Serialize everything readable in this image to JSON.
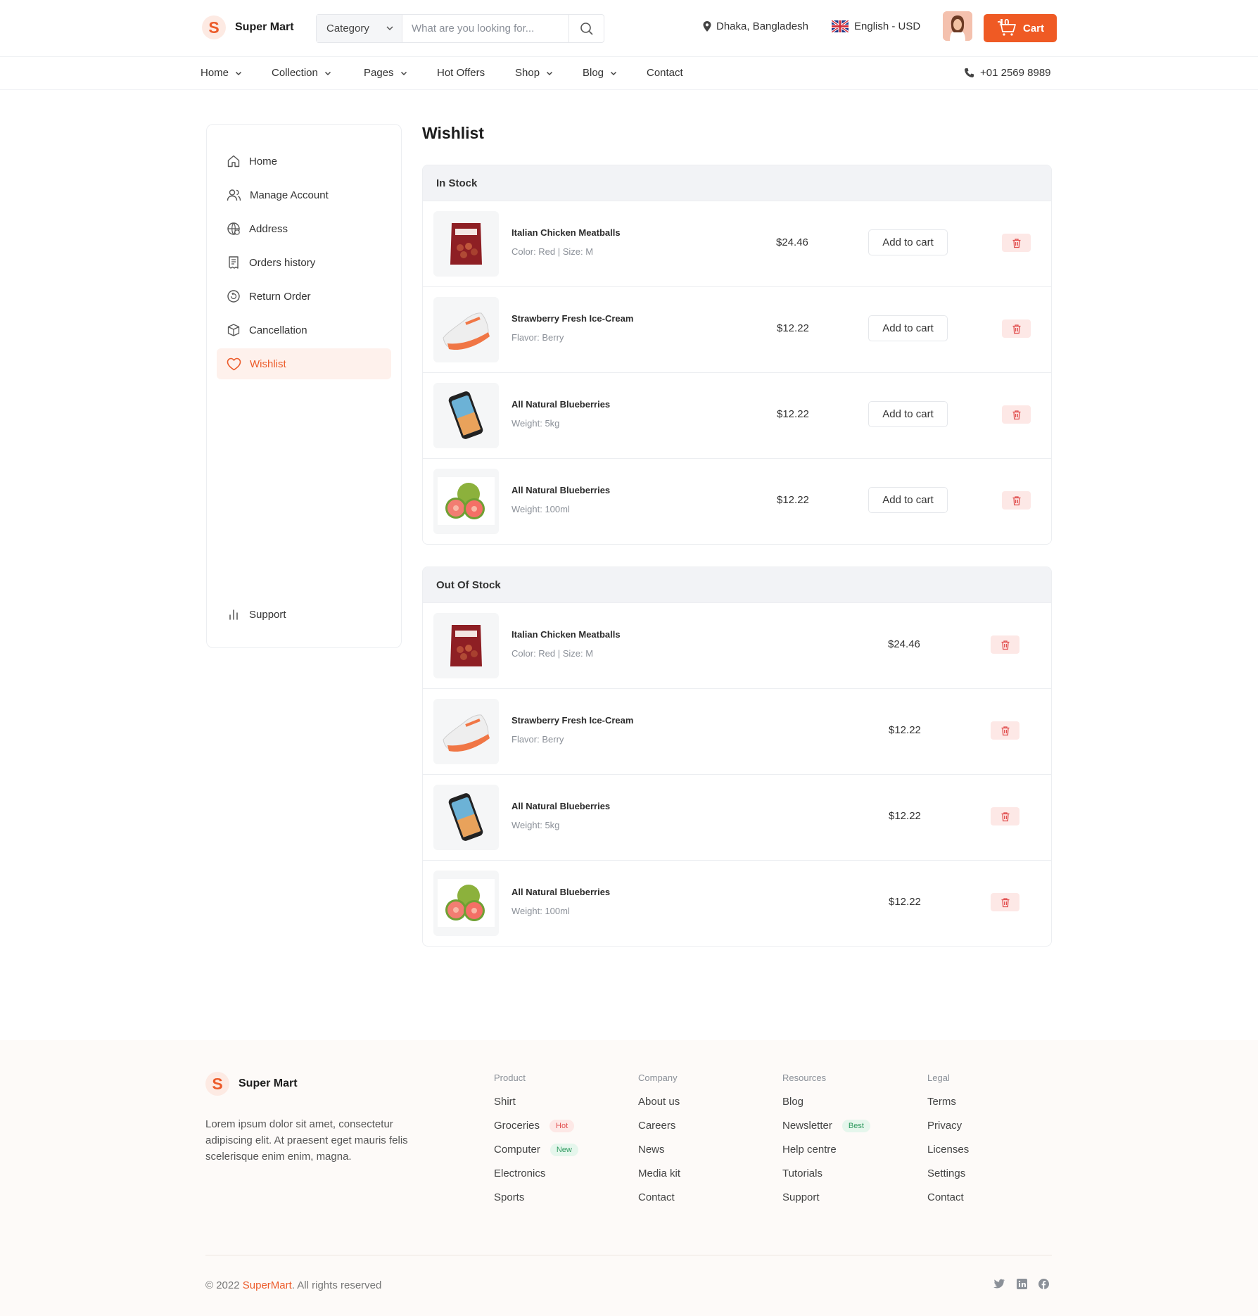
{
  "brand": {
    "name": "Super Mart",
    "letter": "S",
    "accent": "#ef5a24"
  },
  "header": {
    "category_label": "Category",
    "search_placeholder": "What are you looking for...",
    "location": "Dhaka, Bangladesh",
    "language": "English - USD",
    "cart_label": "Cart",
    "cart_count": "10"
  },
  "nav": {
    "items": [
      {
        "label": "Home",
        "has_dropdown": true
      },
      {
        "label": "Collection",
        "has_dropdown": true
      },
      {
        "label": "Pages",
        "has_dropdown": true
      },
      {
        "label": "Hot Offers",
        "has_dropdown": false
      },
      {
        "label": "Shop",
        "has_dropdown": true
      },
      {
        "label": "Blog",
        "has_dropdown": true
      },
      {
        "label": "Contact",
        "has_dropdown": false
      }
    ],
    "phone": "+01 2569 8989"
  },
  "sidebar": {
    "items": [
      {
        "label": "Home",
        "icon": "home-icon"
      },
      {
        "label": "Manage Account",
        "icon": "users-icon"
      },
      {
        "label": "Address",
        "icon": "globe-icon"
      },
      {
        "label": "Orders history",
        "icon": "receipt-icon"
      },
      {
        "label": "Return Order",
        "icon": "return-icon"
      },
      {
        "label": "Cancellation",
        "icon": "box-icon"
      },
      {
        "label": "Wishlist",
        "icon": "heart-icon",
        "active": true
      }
    ],
    "support": "Support"
  },
  "main": {
    "title": "Wishlist",
    "in_stock": {
      "heading": "In Stock",
      "add_label": "Add to cart",
      "items": [
        {
          "name": "Italian Chicken Meatballs",
          "meta": "Color: Red | Size: M",
          "price": "$24.46",
          "image": "meatball-pack"
        },
        {
          "name": "Strawberry Fresh Ice-Cream",
          "meta": "Flavor: Berry",
          "price": "$12.22",
          "image": "sneaker"
        },
        {
          "name": "All Natural Blueberries",
          "meta": "Weight: 5kg",
          "price": "$12.22",
          "image": "phone"
        },
        {
          "name": "All Natural Blueberries",
          "meta": "Weight: 100ml",
          "price": "$12.22",
          "image": "guava"
        }
      ]
    },
    "out_of_stock": {
      "heading": "Out Of Stock",
      "items": [
        {
          "name": "Italian Chicken Meatballs",
          "meta": "Color: Red | Size: M",
          "price": "$24.46",
          "image": "meatball-pack"
        },
        {
          "name": "Strawberry Fresh Ice-Cream",
          "meta": "Flavor: Berry",
          "price": "$12.22",
          "image": "sneaker"
        },
        {
          "name": "All Natural Blueberries",
          "meta": "Weight: 5kg",
          "price": "$12.22",
          "image": "phone"
        },
        {
          "name": "All Natural Blueberries",
          "meta": "Weight: 100ml",
          "price": "$12.22",
          "image": "guava"
        }
      ]
    }
  },
  "footer": {
    "description": "Lorem ipsum dolor sit amet, consectetur adipiscing elit. At praesent eget mauris felis scelerisque enim enim, magna.",
    "columns": [
      {
        "title": "Product",
        "links": [
          {
            "label": "Shirt"
          },
          {
            "label": "Groceries",
            "tag": "Hot"
          },
          {
            "label": "Computer",
            "tag": "New"
          },
          {
            "label": "Electronics"
          },
          {
            "label": "Sports"
          }
        ]
      },
      {
        "title": "Company",
        "links": [
          {
            "label": "About us"
          },
          {
            "label": "Careers"
          },
          {
            "label": "News"
          },
          {
            "label": "Media kit"
          },
          {
            "label": "Contact"
          }
        ]
      },
      {
        "title": "Resources",
        "links": [
          {
            "label": "Blog"
          },
          {
            "label": "Newsletter",
            "tag": "Best"
          },
          {
            "label": "Help centre"
          },
          {
            "label": "Tutorials"
          },
          {
            "label": "Support"
          }
        ]
      },
      {
        "title": "Legal",
        "links": [
          {
            "label": "Terms"
          },
          {
            "label": "Privacy"
          },
          {
            "label": "Licenses"
          },
          {
            "label": "Settings"
          },
          {
            "label": "Contact"
          }
        ]
      }
    ],
    "copyright_prefix": "© 2022 ",
    "copyright_brand": "SuperMart",
    "copyright_suffix": ". All rights reserved",
    "socials": [
      "twitter-icon",
      "linkedin-icon",
      "facebook-icon"
    ]
  }
}
